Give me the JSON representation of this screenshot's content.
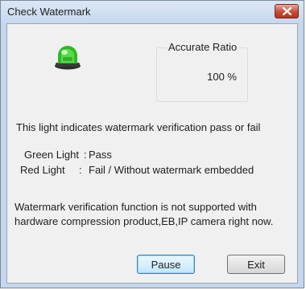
{
  "window": {
    "title": "Check Watermark"
  },
  "icons": {
    "close": "close-x-icon",
    "light": "green-light-icon"
  },
  "colors": {
    "light": "#2fb82a",
    "close_button": "#c74a36",
    "default_button_border": "#3c7fb1"
  },
  "ratio": {
    "group_label": "Accurate Ratio",
    "value": "100 %"
  },
  "info_text": "This light indicates watermark verification pass or fail",
  "legend": {
    "green": {
      "label": "Green Light",
      "separator": ":",
      "value": "Pass"
    },
    "red": {
      "label": "Red Light",
      "separator": ":",
      "value": "Fail / Without watermark embedded"
    }
  },
  "notice": "Watermark verification function is not supported with hardware compression product,EB,IP camera right now.",
  "buttons": {
    "pause": "Pause",
    "exit": "Exit"
  }
}
